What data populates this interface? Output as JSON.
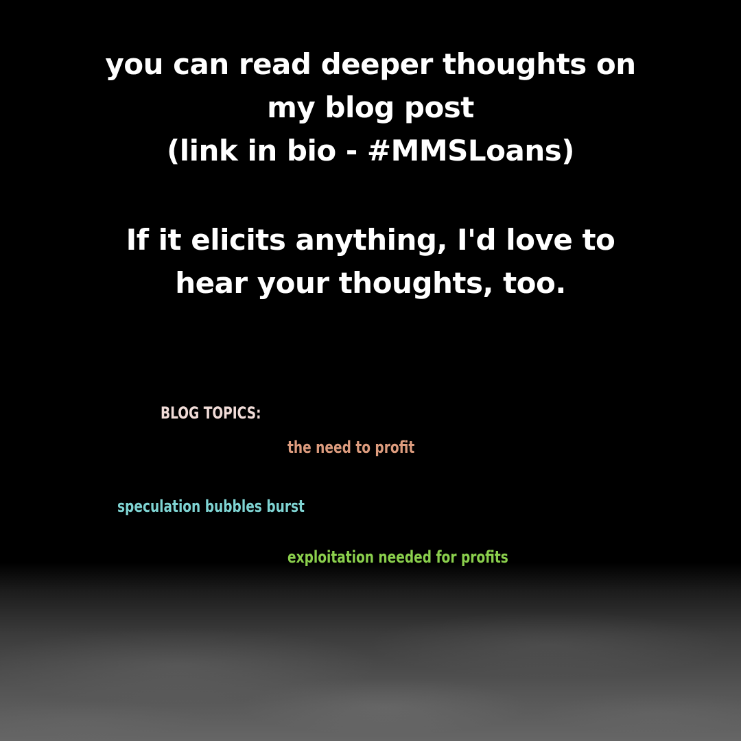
{
  "headline": {
    "lines": [
      "you can read deeper thoughts on",
      "my blog post",
      "(link in bio - #MMSLoans)"
    ]
  },
  "invitation": {
    "lines": [
      "If it elicits anything, I'd love to",
      "hear your thoughts, too."
    ]
  },
  "topics": {
    "label": "BLOG TOPICS:",
    "items": [
      "the need to profit",
      "speculation bubbles burst",
      "exploitation needed for profits"
    ]
  },
  "colors": {
    "background": "#000000",
    "headline_text": "#ffffff",
    "topics_label": "#f1dcd8",
    "topic_1": "#dd9c7e",
    "topic_2": "#7fd4d3",
    "topic_3": "#8bd04d"
  }
}
